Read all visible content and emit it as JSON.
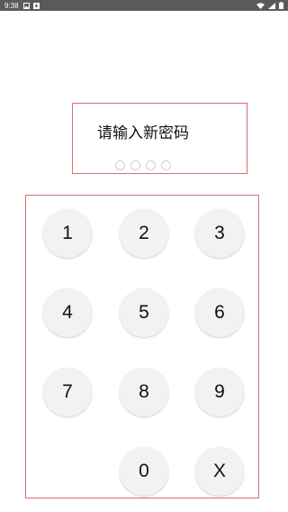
{
  "status_bar": {
    "time": "9:38",
    "notification_icons": [
      "image-icon",
      "download-icon"
    ],
    "right_icons": [
      "wifi-icon",
      "signal-icon",
      "battery-icon"
    ]
  },
  "prompt": {
    "title": "请输入新密码",
    "dot_count": 4
  },
  "keypad": {
    "keys": [
      "1",
      "2",
      "3",
      "4",
      "5",
      "6",
      "7",
      "8",
      "9",
      "0",
      "X"
    ]
  },
  "colors": {
    "outline": "#e06c6c",
    "key_bg": "#f2f2f2",
    "status_bar_bg": "#5a5a5a"
  }
}
